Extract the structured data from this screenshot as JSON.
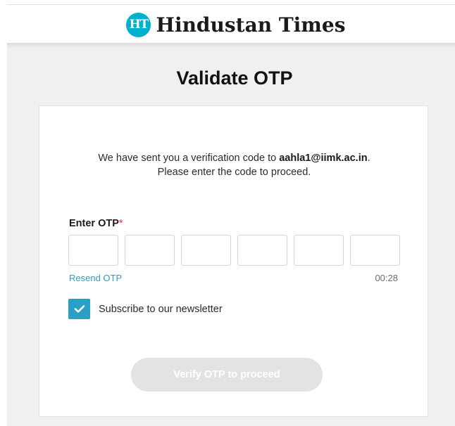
{
  "header": {
    "logo_badge": "HT",
    "logo_text": "Hindustan Times"
  },
  "page": {
    "title": "Validate OTP"
  },
  "message": {
    "line1_prefix": "We have sent you a verification code to ",
    "email": "aahla1@iimk.ac.in",
    "line1_suffix": ".",
    "line2": "Please enter the code to proceed."
  },
  "otp": {
    "label": "Enter OTP",
    "required_mark": "*",
    "digits": [
      "",
      "",
      "",
      "",
      "",
      ""
    ]
  },
  "resend": {
    "label": "Resend OTP"
  },
  "timer": {
    "value": "00:28"
  },
  "subscribe": {
    "label": "Subscribe to our newsletter",
    "checked": true,
    "check_icon": "checkmark-icon"
  },
  "verify": {
    "label": "Verify OTP to proceed",
    "enabled": false
  },
  "colors": {
    "accent": "#2aa0c6",
    "logo_badge": "#00b1cd",
    "required": "#e4323c",
    "disabled_button": "#e3e3e3",
    "background": "#f0f0f0"
  }
}
